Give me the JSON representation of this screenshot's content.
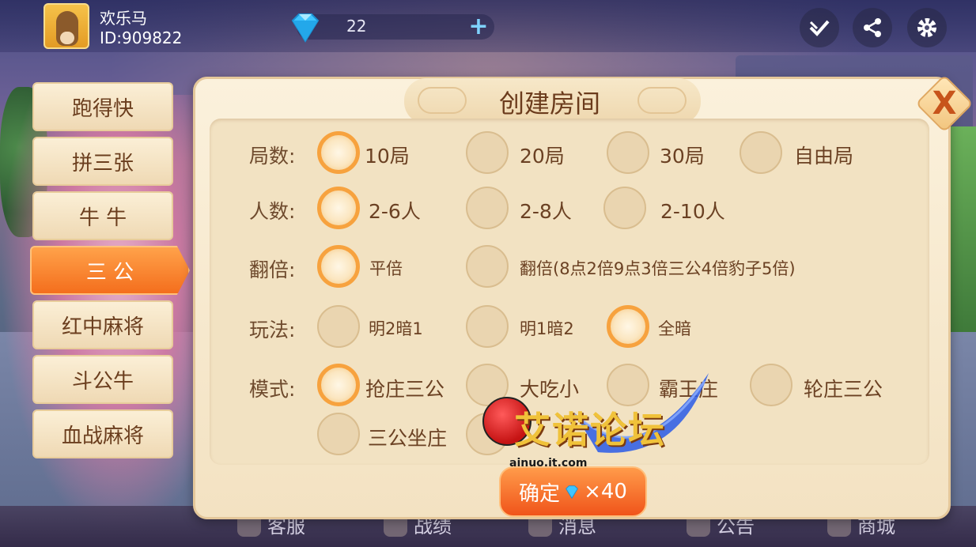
{
  "user": {
    "name": "欢乐马",
    "id": "ID:909822"
  },
  "currency": {
    "gems": "22",
    "add_label": "+"
  },
  "top_actions": {
    "check": "check-icon",
    "share": "share-icon",
    "settings": "gear-icon"
  },
  "tabs": [
    {
      "label": "跑得快"
    },
    {
      "label": "拼三张"
    },
    {
      "label": "牛 牛"
    },
    {
      "label": "三 公",
      "active": true
    },
    {
      "label": "红中麻将"
    },
    {
      "label": "斗公牛"
    },
    {
      "label": "血战麻将"
    }
  ],
  "dialog": {
    "title": "创建房间",
    "close_label": "X",
    "confirm": {
      "label": "确定",
      "cost": "×40"
    }
  },
  "options": {
    "rounds": {
      "label": "局数:",
      "choices": [
        "10局",
        "20局",
        "30局",
        "自由局"
      ],
      "selected": "10局"
    },
    "players": {
      "label": "人数:",
      "choices": [
        "2-6人",
        "2-8人",
        "2-10人"
      ],
      "selected": "2-6人"
    },
    "multiplier": {
      "label": "翻倍:",
      "choices": [
        "平倍",
        "翻倍(8点2倍9点3倍三公4倍豹子5倍)"
      ],
      "selected": "平倍"
    },
    "play": {
      "label": "玩法:",
      "choices": [
        "明2暗1",
        "明1暗2",
        "全暗"
      ],
      "selected": "全暗"
    },
    "mode": {
      "label": "模式:",
      "choices": [
        "抢庄三公",
        "大吃小",
        "霸王庄",
        "轮庄三公",
        "三公坐庄"
      ],
      "selected": "抢庄三公"
    }
  },
  "bottom_nav": [
    "客服",
    "战绩",
    "消息",
    "公告",
    "商城"
  ],
  "watermark": {
    "text": "艾诺论坛",
    "url": "ainuo.it.com"
  },
  "colors": {
    "accent": "#f46e1d",
    "panel": "#fbf1dc",
    "text": "#6b3e1e"
  }
}
